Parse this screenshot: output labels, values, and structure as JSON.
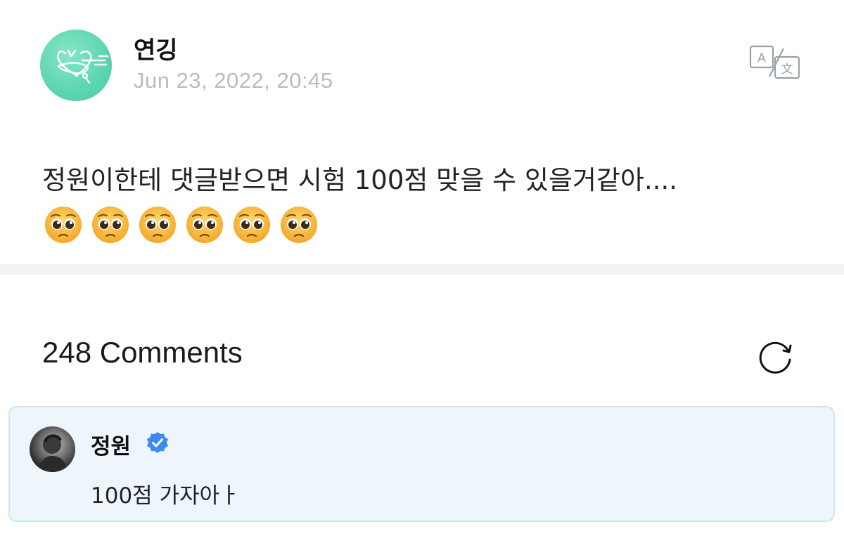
{
  "post": {
    "author": "연깅",
    "date": "Jun 23, 2022, 20:45",
    "text": "정원이한테 댓글받으면 시험 100점 맞을 수 있을거같아....",
    "emojis": [
      "🥺",
      "🥺",
      "🥺",
      "🥺",
      "🥺",
      "🥺"
    ],
    "translate_icon": "translate-icon",
    "avatar_icon": "heart-doodle-avatar"
  },
  "comments": {
    "header": "248 Comments",
    "refresh_icon": "refresh-icon",
    "pinned": {
      "author": "정원",
      "verified_icon": "verified-badge-icon",
      "text": "100점 가자아ㅏ"
    }
  },
  "colors": {
    "avatar_green": "#5fd6b3",
    "date_gray": "#b7bcc4",
    "divider": "#f3f3f6",
    "comment_bg": "#eef6fc",
    "comment_border": "#cfe6ec",
    "verified_blue": "#3d8bf2"
  }
}
